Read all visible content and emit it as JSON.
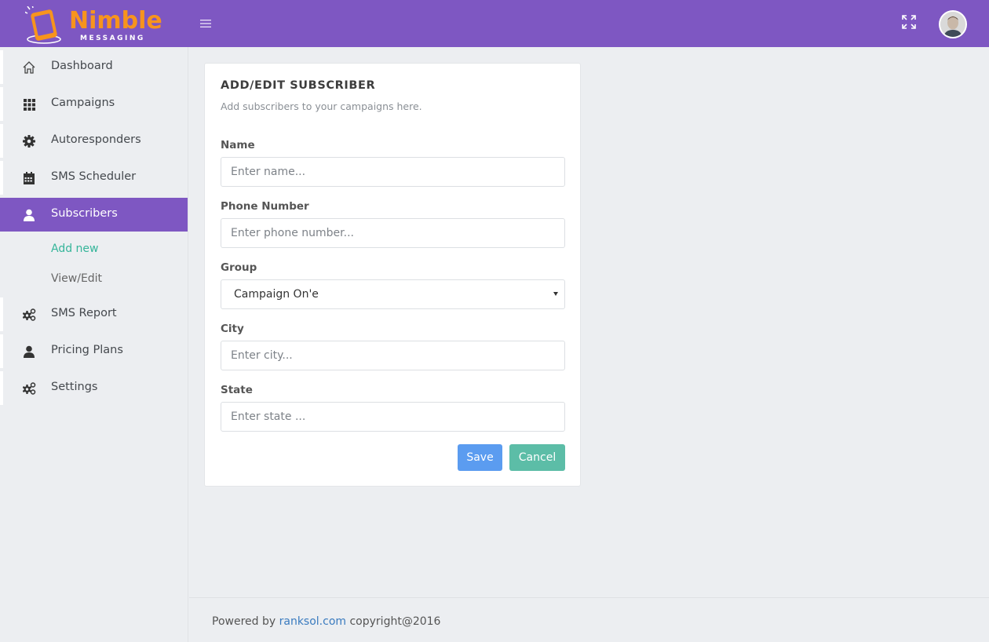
{
  "brand": {
    "name": "Nimble",
    "tagline": "MESSAGING",
    "accent_color": "#f7941d",
    "header_color": "#7e57c2"
  },
  "header": {
    "menu_icon": "hamburger-icon",
    "fullscreen_icon": "expand-icon",
    "avatar_icon": "user-avatar"
  },
  "sidebar": {
    "items": [
      {
        "label": "Dashboard",
        "icon": "home-icon"
      },
      {
        "label": "Campaigns",
        "icon": "grid-icon"
      },
      {
        "label": "Autoresponders",
        "icon": "gear-icon"
      },
      {
        "label": "SMS Scheduler",
        "icon": "calendar-icon"
      },
      {
        "label": "Subscribers",
        "icon": "user-icon",
        "active": true
      },
      {
        "label": "SMS Report",
        "icon": "gears-icon"
      },
      {
        "label": "Pricing Plans",
        "icon": "user-icon"
      },
      {
        "label": "Settings",
        "icon": "gears-icon"
      }
    ],
    "subitems": [
      {
        "label": "Add new",
        "current": true
      },
      {
        "label": "View/Edit"
      }
    ]
  },
  "form": {
    "title": "ADD/EDIT SUBSCRIBER",
    "subtitle": "Add subscribers to your campaigns here.",
    "name_label": "Name",
    "name_placeholder": "Enter name...",
    "phone_label": "Phone Number",
    "phone_placeholder": "Enter phone number...",
    "group_label": "Group",
    "group_value": "Campaign On'e",
    "city_label": "City",
    "city_placeholder": "Enter city...",
    "state_label": "State",
    "state_placeholder": "Enter state ...",
    "save_label": "Save",
    "cancel_label": "Cancel"
  },
  "footer": {
    "prefix": "Powered by",
    "link": "ranksol.com",
    "suffix": "copyright@2016"
  }
}
